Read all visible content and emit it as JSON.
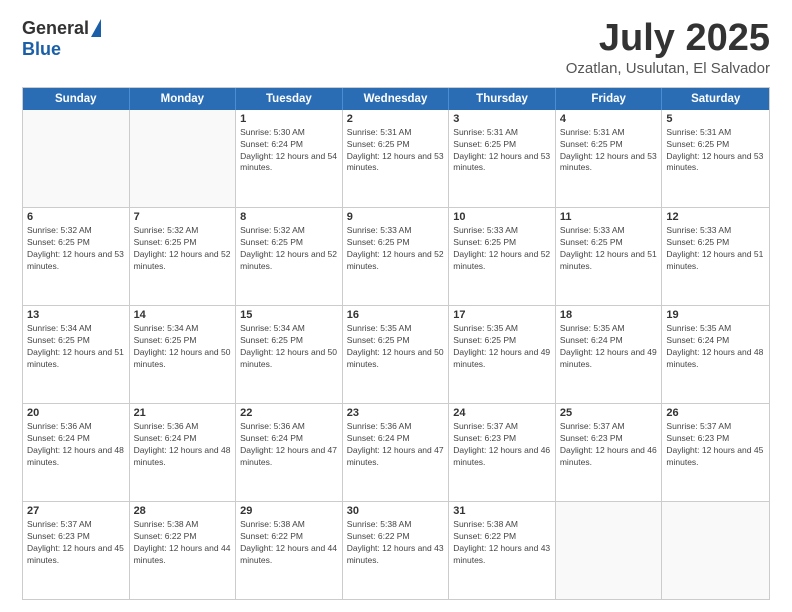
{
  "header": {
    "logo_general": "General",
    "logo_blue": "Blue",
    "title": "July 2025",
    "location": "Ozatlan, Usulutan, El Salvador"
  },
  "days_of_week": [
    "Sunday",
    "Monday",
    "Tuesday",
    "Wednesday",
    "Thursday",
    "Friday",
    "Saturday"
  ],
  "weeks": [
    [
      {
        "day": "",
        "info": ""
      },
      {
        "day": "",
        "info": ""
      },
      {
        "day": "1",
        "info": "Sunrise: 5:30 AM\nSunset: 6:24 PM\nDaylight: 12 hours and 54 minutes."
      },
      {
        "day": "2",
        "info": "Sunrise: 5:31 AM\nSunset: 6:25 PM\nDaylight: 12 hours and 53 minutes."
      },
      {
        "day": "3",
        "info": "Sunrise: 5:31 AM\nSunset: 6:25 PM\nDaylight: 12 hours and 53 minutes."
      },
      {
        "day": "4",
        "info": "Sunrise: 5:31 AM\nSunset: 6:25 PM\nDaylight: 12 hours and 53 minutes."
      },
      {
        "day": "5",
        "info": "Sunrise: 5:31 AM\nSunset: 6:25 PM\nDaylight: 12 hours and 53 minutes."
      }
    ],
    [
      {
        "day": "6",
        "info": "Sunrise: 5:32 AM\nSunset: 6:25 PM\nDaylight: 12 hours and 53 minutes."
      },
      {
        "day": "7",
        "info": "Sunrise: 5:32 AM\nSunset: 6:25 PM\nDaylight: 12 hours and 52 minutes."
      },
      {
        "day": "8",
        "info": "Sunrise: 5:32 AM\nSunset: 6:25 PM\nDaylight: 12 hours and 52 minutes."
      },
      {
        "day": "9",
        "info": "Sunrise: 5:33 AM\nSunset: 6:25 PM\nDaylight: 12 hours and 52 minutes."
      },
      {
        "day": "10",
        "info": "Sunrise: 5:33 AM\nSunset: 6:25 PM\nDaylight: 12 hours and 52 minutes."
      },
      {
        "day": "11",
        "info": "Sunrise: 5:33 AM\nSunset: 6:25 PM\nDaylight: 12 hours and 51 minutes."
      },
      {
        "day": "12",
        "info": "Sunrise: 5:33 AM\nSunset: 6:25 PM\nDaylight: 12 hours and 51 minutes."
      }
    ],
    [
      {
        "day": "13",
        "info": "Sunrise: 5:34 AM\nSunset: 6:25 PM\nDaylight: 12 hours and 51 minutes."
      },
      {
        "day": "14",
        "info": "Sunrise: 5:34 AM\nSunset: 6:25 PM\nDaylight: 12 hours and 50 minutes."
      },
      {
        "day": "15",
        "info": "Sunrise: 5:34 AM\nSunset: 6:25 PM\nDaylight: 12 hours and 50 minutes."
      },
      {
        "day": "16",
        "info": "Sunrise: 5:35 AM\nSunset: 6:25 PM\nDaylight: 12 hours and 50 minutes."
      },
      {
        "day": "17",
        "info": "Sunrise: 5:35 AM\nSunset: 6:25 PM\nDaylight: 12 hours and 49 minutes."
      },
      {
        "day": "18",
        "info": "Sunrise: 5:35 AM\nSunset: 6:24 PM\nDaylight: 12 hours and 49 minutes."
      },
      {
        "day": "19",
        "info": "Sunrise: 5:35 AM\nSunset: 6:24 PM\nDaylight: 12 hours and 48 minutes."
      }
    ],
    [
      {
        "day": "20",
        "info": "Sunrise: 5:36 AM\nSunset: 6:24 PM\nDaylight: 12 hours and 48 minutes."
      },
      {
        "day": "21",
        "info": "Sunrise: 5:36 AM\nSunset: 6:24 PM\nDaylight: 12 hours and 48 minutes."
      },
      {
        "day": "22",
        "info": "Sunrise: 5:36 AM\nSunset: 6:24 PM\nDaylight: 12 hours and 47 minutes."
      },
      {
        "day": "23",
        "info": "Sunrise: 5:36 AM\nSunset: 6:24 PM\nDaylight: 12 hours and 47 minutes."
      },
      {
        "day": "24",
        "info": "Sunrise: 5:37 AM\nSunset: 6:23 PM\nDaylight: 12 hours and 46 minutes."
      },
      {
        "day": "25",
        "info": "Sunrise: 5:37 AM\nSunset: 6:23 PM\nDaylight: 12 hours and 46 minutes."
      },
      {
        "day": "26",
        "info": "Sunrise: 5:37 AM\nSunset: 6:23 PM\nDaylight: 12 hours and 45 minutes."
      }
    ],
    [
      {
        "day": "27",
        "info": "Sunrise: 5:37 AM\nSunset: 6:23 PM\nDaylight: 12 hours and 45 minutes."
      },
      {
        "day": "28",
        "info": "Sunrise: 5:38 AM\nSunset: 6:22 PM\nDaylight: 12 hours and 44 minutes."
      },
      {
        "day": "29",
        "info": "Sunrise: 5:38 AM\nSunset: 6:22 PM\nDaylight: 12 hours and 44 minutes."
      },
      {
        "day": "30",
        "info": "Sunrise: 5:38 AM\nSunset: 6:22 PM\nDaylight: 12 hours and 43 minutes."
      },
      {
        "day": "31",
        "info": "Sunrise: 5:38 AM\nSunset: 6:22 PM\nDaylight: 12 hours and 43 minutes."
      },
      {
        "day": "",
        "info": ""
      },
      {
        "day": "",
        "info": ""
      }
    ]
  ]
}
